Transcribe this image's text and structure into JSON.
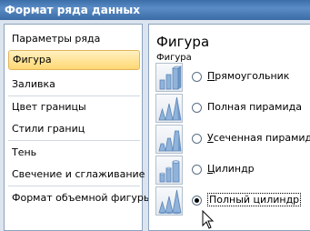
{
  "window": {
    "title": "Формат ряда данных"
  },
  "nav": {
    "items": [
      {
        "label": "Параметры ряда"
      },
      {
        "label": "Фигура"
      },
      {
        "label": "Заливка"
      },
      {
        "label": "Цвет границы"
      },
      {
        "label": "Стили границ"
      },
      {
        "label": "Тень"
      },
      {
        "label": "Свечение и сглаживание"
      },
      {
        "label": "Формат объемной фигуры"
      }
    ],
    "selected": "Фигура"
  },
  "panel": {
    "title": "Фигура",
    "subtitle": "Фигура",
    "options": [
      {
        "accel": "П",
        "rest": "рямоугольник",
        "icon": "box-icon",
        "checked": false
      },
      {
        "accel": "",
        "rest": "Полная пирамида",
        "icon": "full-pyramid-icon",
        "checked": false
      },
      {
        "accel": "У",
        "rest": "сеченная пирамида",
        "icon": "truncated-pyramid-icon",
        "checked": false
      },
      {
        "accel": "Ц",
        "rest": "илиндр",
        "icon": "cylinder-icon",
        "checked": false
      },
      {
        "accel": "",
        "rest": "Полный цилиндр",
        "icon": "full-cylinder-icon",
        "checked": true
      }
    ]
  },
  "colors": {
    "title_bar": "#3b6ea8",
    "selection": "#ffd873",
    "shape_fill": "#8fb3da"
  }
}
